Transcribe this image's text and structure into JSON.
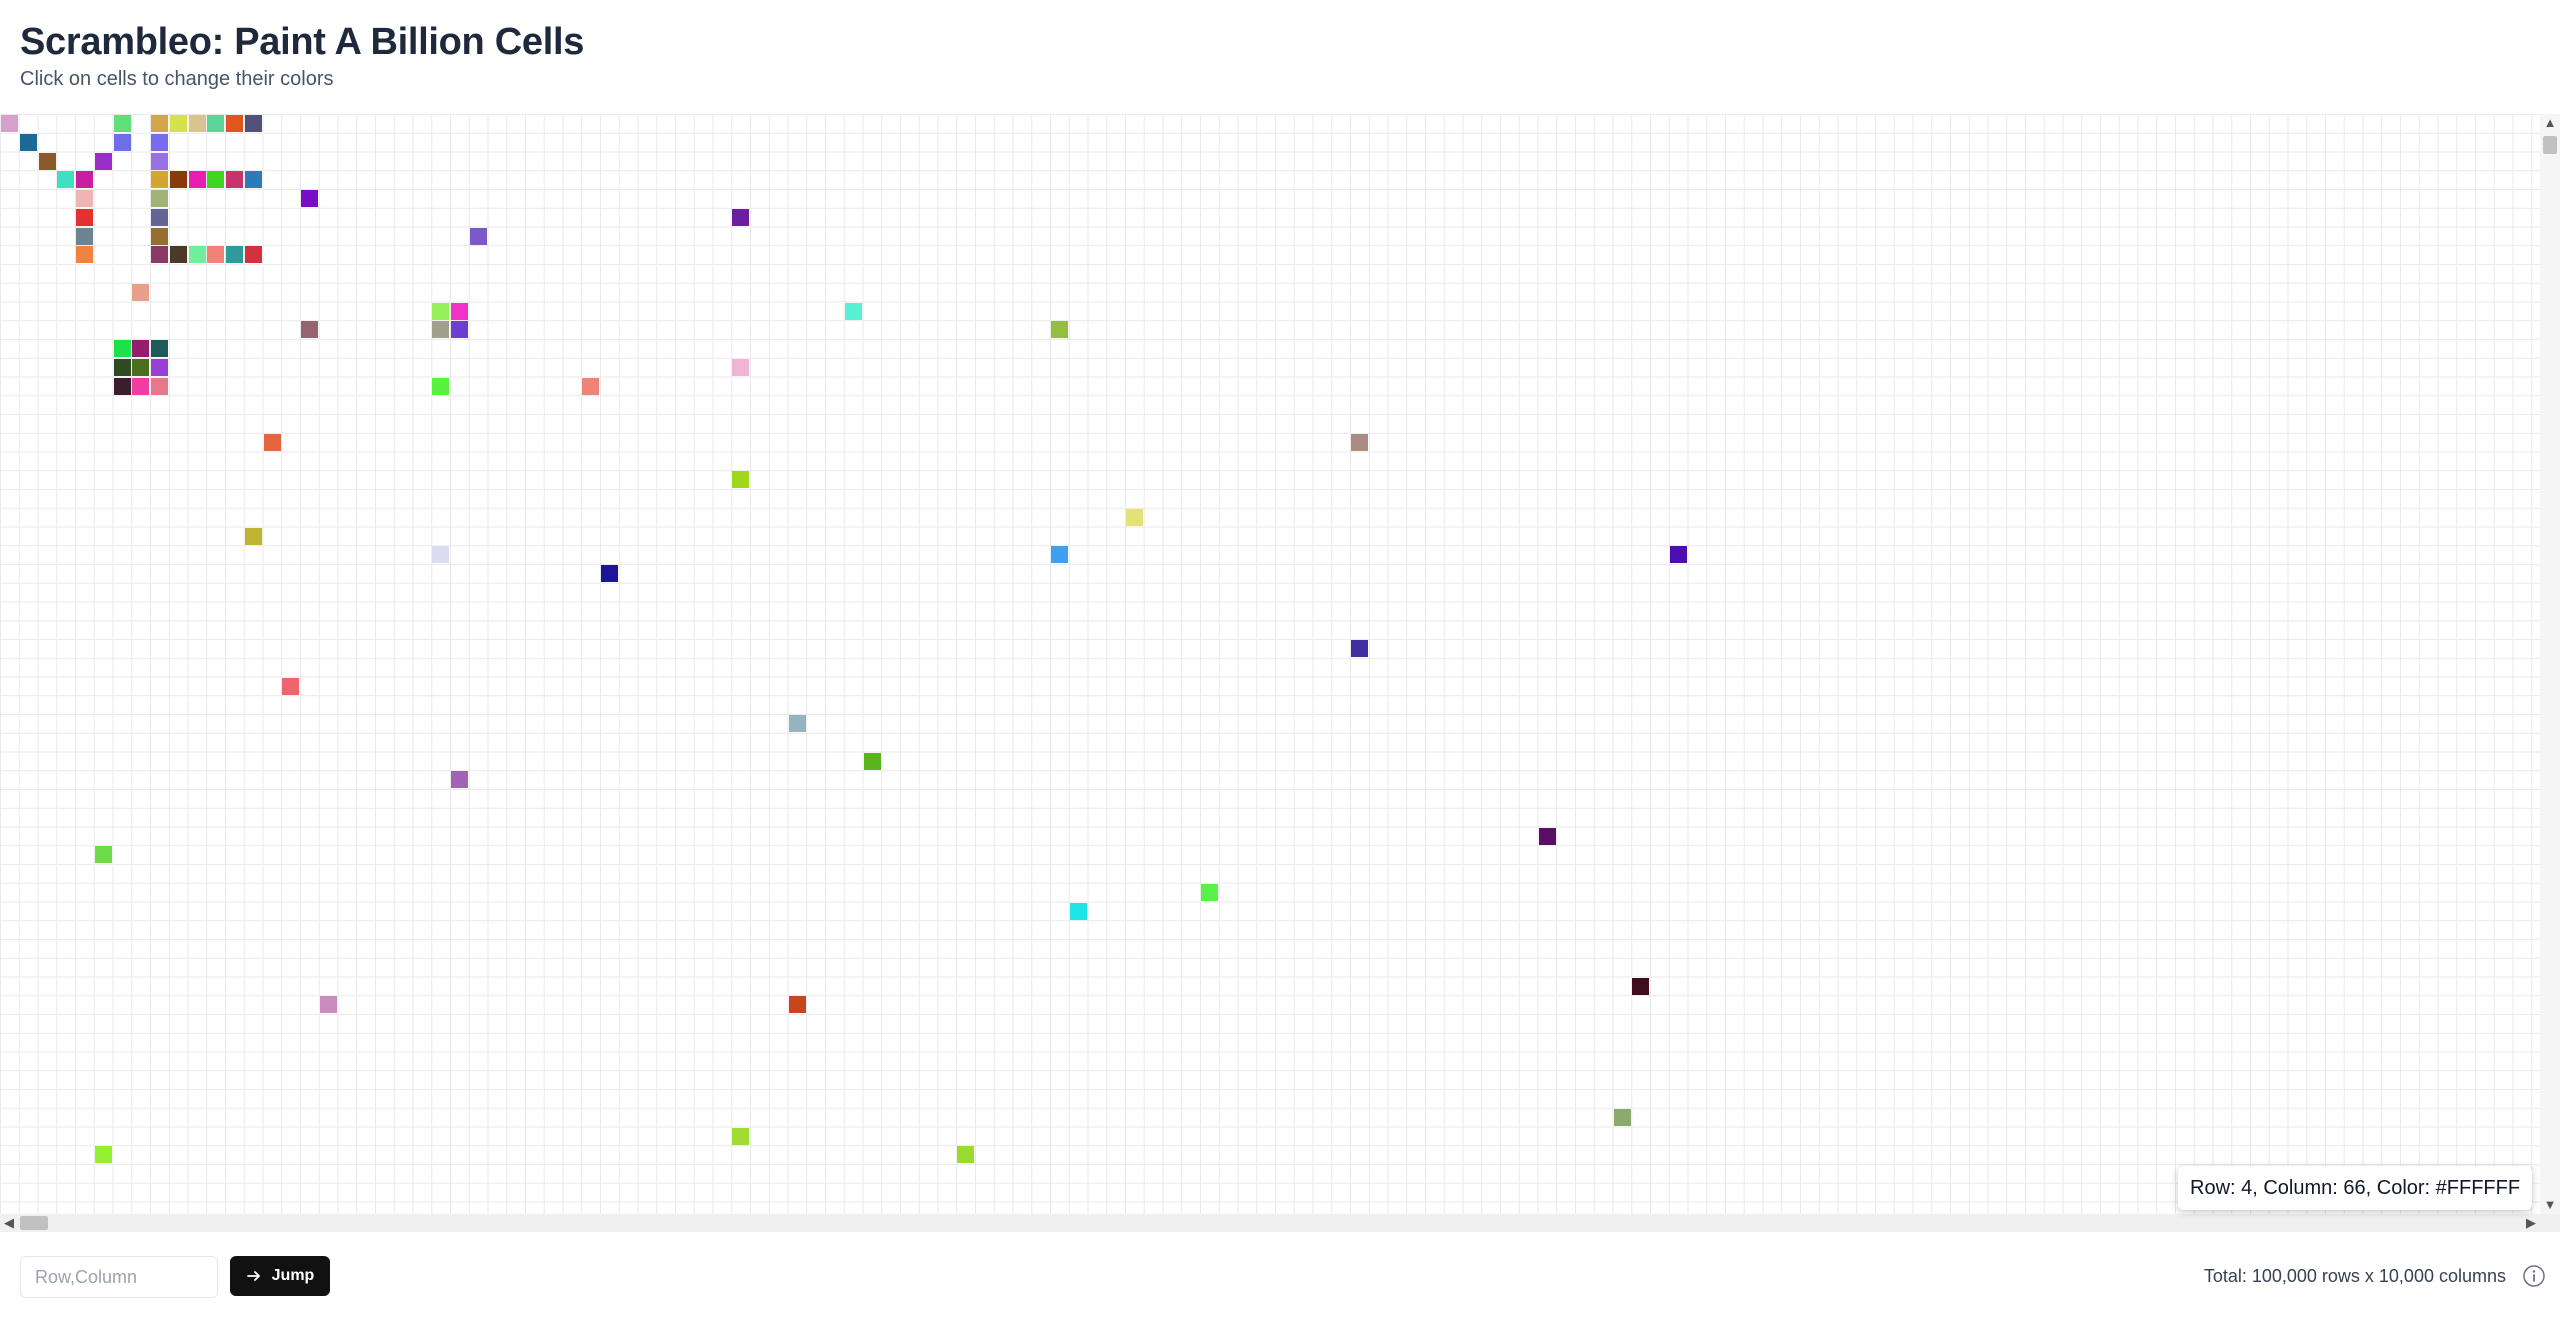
{
  "header": {
    "title": "Scrambleo: Paint A Billion Cells",
    "subtitle": "Click on cells to change their colors"
  },
  "grid": {
    "default_color": "#FFFFFF",
    "gridline_color": "#E9E9E9",
    "painted_cells": [
      {
        "row": 0,
        "col": 0,
        "color": "#D6A0CC"
      },
      {
        "row": 0,
        "col": 6,
        "color": "#5DE07A"
      },
      {
        "row": 0,
        "col": 8,
        "color": "#D4A64A"
      },
      {
        "row": 0,
        "col": 9,
        "color": "#D4E34A"
      },
      {
        "row": 0,
        "col": 10,
        "color": "#D9C38F"
      },
      {
        "row": 0,
        "col": 11,
        "color": "#5AD69A"
      },
      {
        "row": 0,
        "col": 12,
        "color": "#E0561E"
      },
      {
        "row": 0,
        "col": 13,
        "color": "#505078"
      },
      {
        "row": 1,
        "col": 1,
        "color": "#1E6A96"
      },
      {
        "row": 1,
        "col": 6,
        "color": "#6E6EE8"
      },
      {
        "row": 1,
        "col": 8,
        "color": "#7A6CF0"
      },
      {
        "row": 2,
        "col": 2,
        "color": "#8A5A2A"
      },
      {
        "row": 2,
        "col": 5,
        "color": "#9A2EC8"
      },
      {
        "row": 2,
        "col": 8,
        "color": "#9A70E6"
      },
      {
        "row": 3,
        "col": 3,
        "color": "#3EE0C0"
      },
      {
        "row": 3,
        "col": 4,
        "color": "#C81EA0"
      },
      {
        "row": 3,
        "col": 8,
        "color": "#D4A630"
      },
      {
        "row": 3,
        "col": 9,
        "color": "#8A3A08"
      },
      {
        "row": 3,
        "col": 10,
        "color": "#E81EB4"
      },
      {
        "row": 3,
        "col": 11,
        "color": "#3ED61E"
      },
      {
        "row": 3,
        "col": 12,
        "color": "#C8326E"
      },
      {
        "row": 3,
        "col": 13,
        "color": "#2E7AB8"
      },
      {
        "row": 4,
        "col": 4,
        "color": "#F0B4B4"
      },
      {
        "row": 4,
        "col": 8,
        "color": "#A0B478"
      },
      {
        "row": 4,
        "col": 16,
        "color": "#7A0EC8"
      },
      {
        "row": 5,
        "col": 4,
        "color": "#E03232"
      },
      {
        "row": 5,
        "col": 8,
        "color": "#646496"
      },
      {
        "row": 5,
        "col": 39,
        "color": "#6A1EA0"
      },
      {
        "row": 6,
        "col": 4,
        "color": "#6E8290"
      },
      {
        "row": 6,
        "col": 8,
        "color": "#966E2E"
      },
      {
        "row": 6,
        "col": 25,
        "color": "#7A5AC8"
      },
      {
        "row": 7,
        "col": 4,
        "color": "#F0823E"
      },
      {
        "row": 7,
        "col": 8,
        "color": "#8A3A64"
      },
      {
        "row": 7,
        "col": 9,
        "color": "#4A3A2A"
      },
      {
        "row": 7,
        "col": 10,
        "color": "#6EF09A"
      },
      {
        "row": 7,
        "col": 11,
        "color": "#F08278"
      },
      {
        "row": 7,
        "col": 12,
        "color": "#2E9A9A"
      },
      {
        "row": 7,
        "col": 13,
        "color": "#D2323E"
      },
      {
        "row": 9,
        "col": 7,
        "color": "#E6A08C"
      },
      {
        "row": 10,
        "col": 23,
        "color": "#96F05A"
      },
      {
        "row": 10,
        "col": 24,
        "color": "#F032C8"
      },
      {
        "row": 10,
        "col": 45,
        "color": "#5AF0D6"
      },
      {
        "row": 11,
        "col": 16,
        "color": "#966470"
      },
      {
        "row": 11,
        "col": 23,
        "color": "#A0A08C"
      },
      {
        "row": 11,
        "col": 24,
        "color": "#6E3ECE"
      },
      {
        "row": 11,
        "col": 56,
        "color": "#96BE3E"
      },
      {
        "row": 12,
        "col": 6,
        "color": "#1EE04A"
      },
      {
        "row": 12,
        "col": 7,
        "color": "#961E6E"
      },
      {
        "row": 12,
        "col": 8,
        "color": "#1E5A5A"
      },
      {
        "row": 13,
        "col": 6,
        "color": "#2E4A1E"
      },
      {
        "row": 13,
        "col": 7,
        "color": "#4A6E1E"
      },
      {
        "row": 13,
        "col": 8,
        "color": "#9A3ED6"
      },
      {
        "row": 13,
        "col": 39,
        "color": "#F0B4D6"
      },
      {
        "row": 14,
        "col": 6,
        "color": "#3A1E2E"
      },
      {
        "row": 14,
        "col": 7,
        "color": "#F03EA0"
      },
      {
        "row": 14,
        "col": 8,
        "color": "#E6788C"
      },
      {
        "row": 14,
        "col": 23,
        "color": "#5AF03E"
      },
      {
        "row": 14,
        "col": 31,
        "color": "#F08278"
      },
      {
        "row": 17,
        "col": 14,
        "color": "#E6643E"
      },
      {
        "row": 17,
        "col": 72,
        "color": "#AA8C82"
      },
      {
        "row": 19,
        "col": 39,
        "color": "#A0D61E"
      },
      {
        "row": 21,
        "col": 60,
        "color": "#E6E078"
      },
      {
        "row": 22,
        "col": 13,
        "color": "#BEB432"
      },
      {
        "row": 23,
        "col": 23,
        "color": "#DCDCF0"
      },
      {
        "row": 23,
        "col": 56,
        "color": "#3EA0F0"
      },
      {
        "row": 23,
        "col": 89,
        "color": "#4A0EB4"
      },
      {
        "row": 24,
        "col": 32,
        "color": "#1E1496"
      },
      {
        "row": 28,
        "col": 72,
        "color": "#3E2EA0"
      },
      {
        "row": 30,
        "col": 15,
        "color": "#F0646E"
      },
      {
        "row": 32,
        "col": 42,
        "color": "#96B4BE"
      },
      {
        "row": 34,
        "col": 46,
        "color": "#5AB41E"
      },
      {
        "row": 35,
        "col": 24,
        "color": "#A064B4"
      },
      {
        "row": 38,
        "col": 82,
        "color": "#5A0E64"
      },
      {
        "row": 39,
        "col": 5,
        "color": "#6EDC4A"
      },
      {
        "row": 41,
        "col": 64,
        "color": "#5AF04A"
      },
      {
        "row": 42,
        "col": 57,
        "color": "#1EE6E6"
      },
      {
        "row": 46,
        "col": 87,
        "color": "#3E0E1E"
      },
      {
        "row": 47,
        "col": 17,
        "color": "#C88CBE"
      },
      {
        "row": 47,
        "col": 42,
        "color": "#C8461E"
      },
      {
        "row": 53,
        "col": 86,
        "color": "#8CAA6E"
      },
      {
        "row": 54,
        "col": 39,
        "color": "#A0DC32"
      },
      {
        "row": 55,
        "col": 5,
        "color": "#96F032"
      },
      {
        "row": 55,
        "col": 51,
        "color": "#96DC32"
      }
    ]
  },
  "tooltip": {
    "text": "Row: 4, Column: 66, Color: #FFFFFF"
  },
  "footer": {
    "jump_input": {
      "placeholder": "Row,Column",
      "value": ""
    },
    "jump_button_label": "Jump",
    "total_text": "Total: 100,000 rows x 10,000 columns"
  },
  "icons": {
    "jump_button": "arrow-right-icon",
    "footer_info": "info-icon",
    "scroll_up": "chevron-up-icon",
    "scroll_down": "chevron-down-icon",
    "scroll_left": "chevron-left-icon",
    "scroll_right": "chevron-right-icon"
  }
}
